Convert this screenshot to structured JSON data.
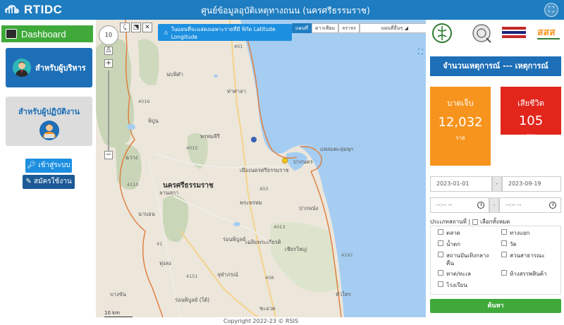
{
  "header": {
    "brand": "RTIDC",
    "title": "ศูนย์ข้อมูลอุบัติเหตุทางถนน (นครศรีธรรมราช)"
  },
  "sidebar": {
    "dashboard_label": "Dashboard",
    "admin_label": "สำหรับผู้บริหาร",
    "operator_label": "สำหรับผู้ปฏิบัติงาน",
    "login_label": "เข้าสู่ระบบ",
    "register_label": "สมัครใช้งาน"
  },
  "map": {
    "notice": "ในแผนที่จะแสดงเฉพาะรายที่มี พิกัด Latitude Longitude",
    "zoom_value": "10",
    "types": [
      "แผนที่",
      "ดาวเทียม",
      "จราจร"
    ],
    "type_select": "แผนที่อื่นๆ",
    "labels": {
      "nopphitam": "นบพิตำ",
      "thasala": "ท่าศาลา",
      "phipun": "พิปูน",
      "phrom": "พรหมคีรี",
      "chawang": "ฉวาง",
      "muang": "เมืองนครศรีธรรมราช",
      "province": "นครศรีธรรมราช",
      "lansaka": "ลานสกา",
      "phraphrom": "พระพรหม",
      "pakphanang": "ปากพนัง",
      "laemtalumphuk": "แหลมตะลุมพุก",
      "paknakhon": "ปากนคร",
      "chianyai": "เชียรใหญ่",
      "chaloem": "เฉลิมพระเกียรติ",
      "ronphibun": "ร่อนพิบูลย์",
      "napho": "นาบอน",
      "thungsong": "ทุ่งสง",
      "chulabhorn": "จุฬาภรณ์",
      "huasai": "หัวไทร",
      "bangkhan": "บางขัน",
      "chaiya": "ชะอวด",
      "rongphibun2": "ร่อนพิบูลย์ (ใต้)"
    },
    "roads": [
      "401",
      "4016",
      "4015",
      "403",
      "4013",
      "408",
      "41",
      "4151",
      "4110",
      "4197"
    ],
    "scale": "10 km"
  },
  "right": {
    "count_title": "จำนวนเหตุการณ์ --- เหตุการณ์",
    "injured_title": "บาดเจ็บ",
    "injured_value": "12,032",
    "injured_unit": "ราย",
    "dead_title": "เสียชีวิต",
    "dead_value": "105",
    "dead_unit": "ราย",
    "date_from": "2023-01-01",
    "date_to": "2023-09-19",
    "date_sep": "-",
    "time_from": "--:-- --",
    "time_to": "--:-- --",
    "place_type_label": "ประเภทสถานที่ |",
    "select_all": "เลือกทั้งหมด",
    "places": [
      "ตลาด",
      "ทางแยก",
      "น้ำตก",
      "วัด",
      "สถานบันเทิงกลางคืน",
      "สวนสาธารณะ",
      "หาด/ทะเล",
      "ห้างสรรพสินค้า",
      "โรงเรียน"
    ],
    "search_label": "ค้นหา",
    "brand_colors": {
      "injured": "#f7941d",
      "dead": "#e2261c",
      "primary": "#1d6fb7",
      "green": "#3faa3a"
    }
  },
  "footer": {
    "copyright": "Copyright 2022-23 © RSIS"
  }
}
